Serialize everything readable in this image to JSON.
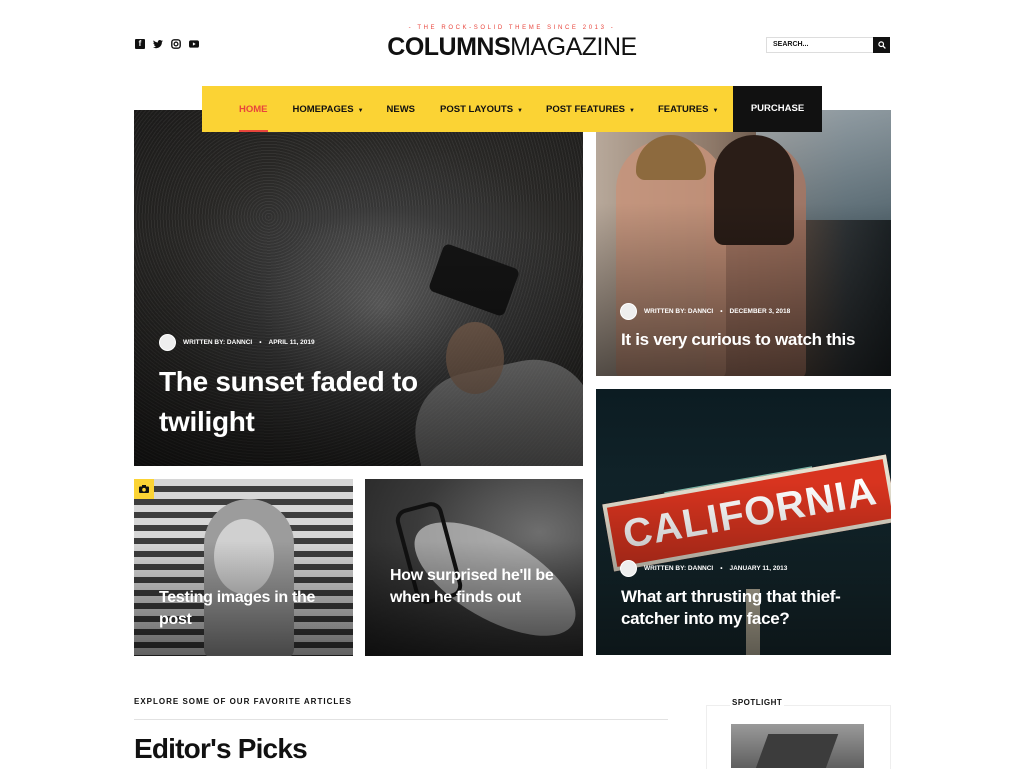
{
  "header": {
    "tagline": "- THE ROCK-SOLID THEME SINCE 2013 -",
    "logo_bold": "COLUMNS",
    "logo_light": "MAGAZINE",
    "social_icons": [
      "facebook-icon",
      "twitter-icon",
      "instagram-icon",
      "youtube-icon"
    ],
    "search": {
      "placeholder": "SEARCH..."
    }
  },
  "nav": {
    "items": [
      {
        "label": "HOME",
        "active": true,
        "dropdown": false
      },
      {
        "label": "HOMEPAGES",
        "active": false,
        "dropdown": true
      },
      {
        "label": "NEWS",
        "active": false,
        "dropdown": false
      },
      {
        "label": "POST LAYOUTS",
        "active": false,
        "dropdown": true
      },
      {
        "label": "POST FEATURES",
        "active": false,
        "dropdown": true
      },
      {
        "label": "FEATURES",
        "active": false,
        "dropdown": true
      }
    ],
    "caret": "▼",
    "purchase_label": "PURCHASE"
  },
  "posts": {
    "main": {
      "author": "WRITTEN BY: DANNCI",
      "date": "APRIL 11, 2019",
      "title": "The sunset faded to twilight"
    },
    "couple": {
      "author": "WRITTEN BY: DANNCI",
      "date": "DECEMBER 3, 2018",
      "title": "It is very curious to watch this"
    },
    "woman": {
      "title": "Testing images in the post",
      "badge_icon": "camera-icon"
    },
    "lamp": {
      "title": "How surprised he'll be when he finds out"
    },
    "california": {
      "author": "WRITTEN BY: DANNCI",
      "date": "JANUARY 11, 2013",
      "title": "What art thrusting that thief-catcher into my face?"
    }
  },
  "section": {
    "explore": "EXPLORE SOME OF OUR FAVORITE ARTICLES",
    "editors_picks": "Editor's Picks",
    "spotlight": "SPOTLIGHT"
  },
  "colors": {
    "accent_yellow": "#fbd334",
    "accent_red": "#e8453c",
    "dark": "#111111"
  }
}
